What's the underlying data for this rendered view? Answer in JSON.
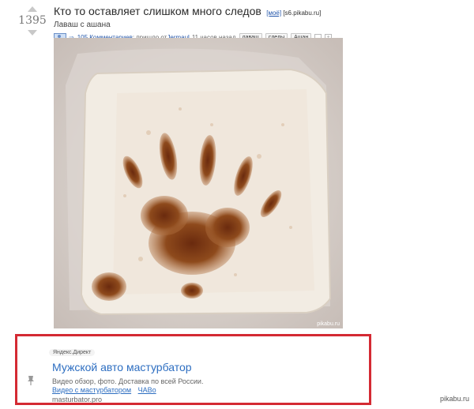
{
  "post": {
    "score": "1395",
    "title": "Кто то оставляет слишком много следов",
    "nsfw_tag": "[моё]",
    "source_tag": "[s6.pikabu.ru]",
    "subtitle": "Лаваш с ашана",
    "comments_link": "105 Комментариев",
    "meta_text": "; пришло от ",
    "author": "Jermaul",
    "time_ago": "11 часов назад",
    "tags": [
      "лаваш",
      "следы",
      "Ашан"
    ],
    "image_watermark": "pikabu.ru"
  },
  "ad": {
    "badge": "Яндекс.Директ",
    "title": "Мужской авто мастурбатор",
    "description": "Видео обзор, фото. Доставка по всей России.",
    "links": [
      "Видео с мастурбатором",
      "ЧАВо"
    ],
    "domain": "masturbator.pro"
  },
  "corner_watermark": "pikabu.ru",
  "icons": [
    "vote-up-icon",
    "vote-down-icon",
    "camera-icon",
    "pin-icon"
  ]
}
